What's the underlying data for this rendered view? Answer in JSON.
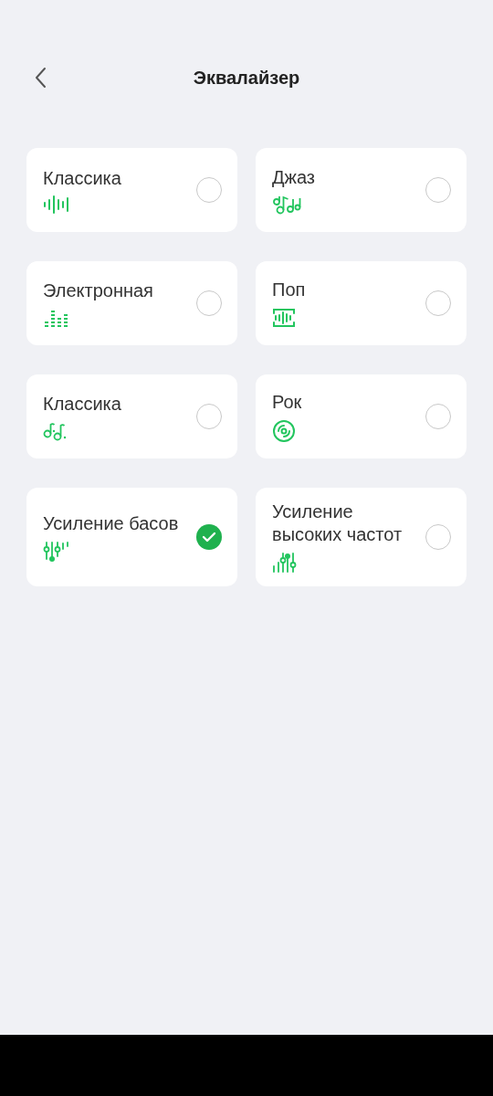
{
  "header": {
    "title": "Эквалайзер"
  },
  "presets": [
    {
      "label": "Классика",
      "kind": "wave",
      "selected": false
    },
    {
      "label": "Джаз",
      "kind": "notes",
      "selected": false
    },
    {
      "label": "Электронная",
      "kind": "levels",
      "selected": false
    },
    {
      "label": "Поп",
      "kind": "voice",
      "selected": false
    },
    {
      "label": "Классика",
      "kind": "melody",
      "selected": false
    },
    {
      "label": "Рок",
      "kind": "disc",
      "selected": false
    },
    {
      "label": "Усиление басов",
      "kind": "bass",
      "selected": true
    },
    {
      "label": "Усиление высоких частот",
      "kind": "treble",
      "selected": false
    }
  ]
}
